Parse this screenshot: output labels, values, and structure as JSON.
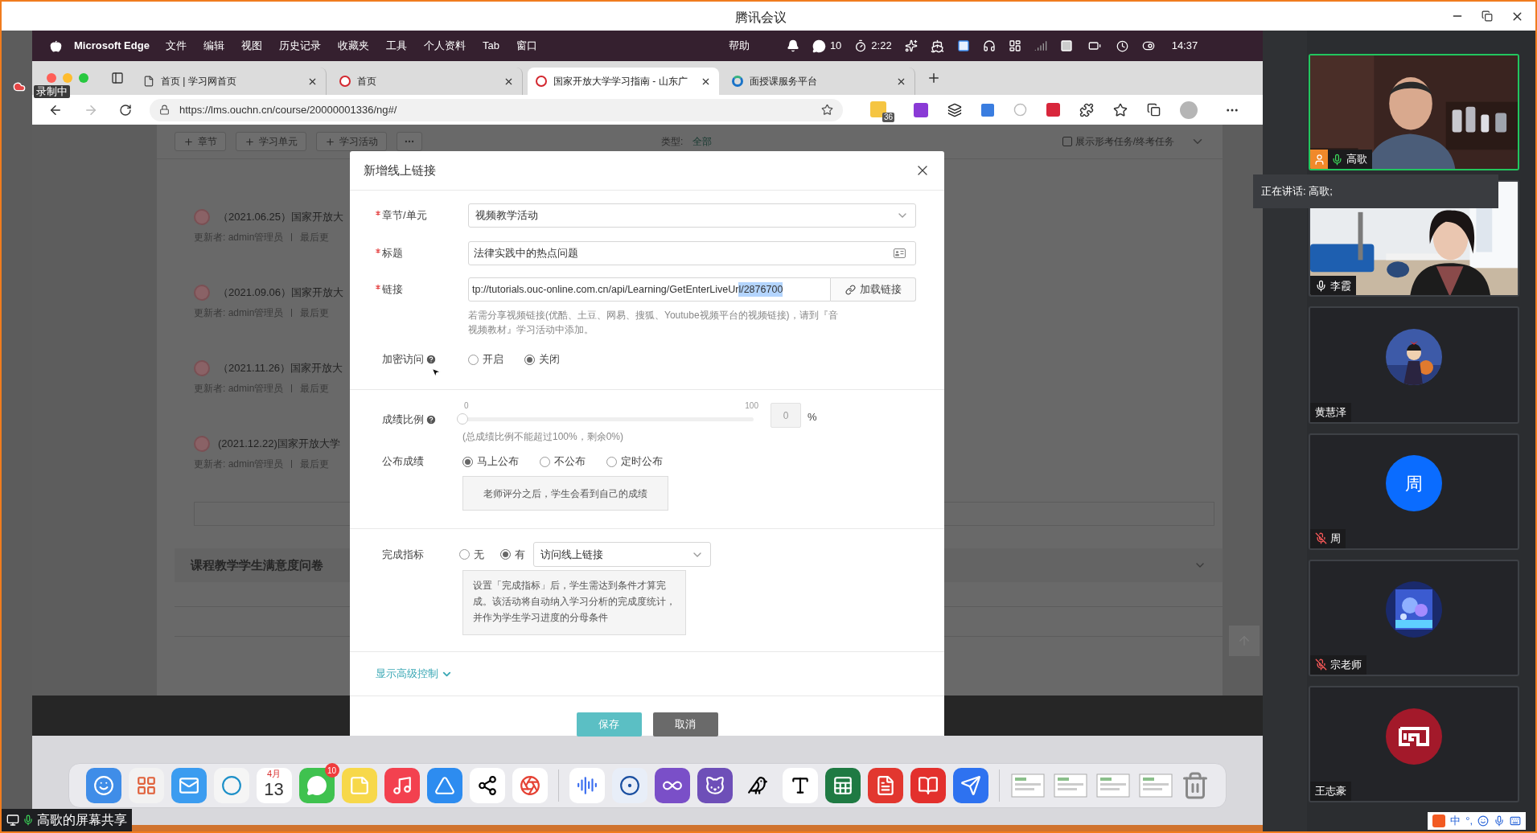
{
  "window": {
    "title": "腾讯会议"
  },
  "recording": {
    "label": "录制中"
  },
  "share_label": "高歌的屏幕共享",
  "mac_menu": {
    "app": "Microsoft Edge",
    "items": [
      "文件",
      "编辑",
      "视图",
      "历史记录",
      "收藏夹",
      "工具",
      "个人资料",
      "Tab",
      "窗口"
    ],
    "help": "帮助",
    "chat_count": "10",
    "timer": "2:22",
    "clock": "14:37"
  },
  "browser": {
    "tabs": [
      {
        "title": "首页 | 学习网首页",
        "selected": false,
        "kind": "page"
      },
      {
        "title": "首页",
        "selected": false,
        "kind": "logo"
      },
      {
        "title": "国家开放大学学习指南 - 山东广",
        "selected": true,
        "kind": "logo"
      },
      {
        "title": "面授课服务平台",
        "selected": false,
        "kind": "swirl"
      }
    ],
    "url": "https://lms.ouchn.cn/course/20000001336/ng#/",
    "extension_badge": "36"
  },
  "page": {
    "toolbar_buttons": [
      "章节",
      "学习单元",
      "学习活动"
    ],
    "type_label": "类型:",
    "type_value": "全部",
    "show_exam_tasks": {
      "label": "展示形考任务/终考任务",
      "checked": false
    },
    "items": [
      {
        "title": "（2021.06.25）国家开放大",
        "meta": "更新者: admin管理员",
        "meta_2": "最后更"
      },
      {
        "title": "（2021.09.06）国家开放大",
        "meta": "更新者: admin管理员",
        "meta_2": "最后更"
      },
      {
        "title": "（2021.11.26）国家开放大",
        "meta": "更新者: admin管理员",
        "meta_2": "最后更"
      },
      {
        "title": "(2021.12.22)国家开放大学",
        "meta": "更新者: admin管理员",
        "meta_2": "最后更"
      }
    ],
    "section_title": "课程教学学生满意度问卷"
  },
  "dialog": {
    "title": "新增线上链接",
    "chapter": {
      "label": "章节/单元",
      "required": true,
      "value": "视频教学活动"
    },
    "name": {
      "label": "标题",
      "required": true,
      "value": "法律实践中的热点问题"
    },
    "link": {
      "label": "链接",
      "required": true,
      "value": "tp://tutorials.ouc-online.com.cn/api/Learning/GetEnterLiveUr",
      "selected_text": "l/2876700",
      "button": "加载链接",
      "hint": "若需分享视频链接(优酷、土豆、网易、搜狐、Youtube视频平台的视频链接)，请到『音视频教材』学习活动中添加。"
    },
    "encrypted": {
      "label": "加密访问",
      "options": [
        {
          "label": "开启",
          "selected": false
        },
        {
          "label": "关闭",
          "selected": true
        }
      ]
    },
    "score": {
      "label": "成绩比例",
      "min": "0",
      "max": "100",
      "level": 0,
      "placeholder": "0",
      "unit": "%",
      "hint": "(总成绩比例不能超过100%，剩余0%)"
    },
    "publish": {
      "label": "公布成绩",
      "options": [
        {
          "label": "马上公布",
          "selected": true
        },
        {
          "label": "不公布",
          "selected": false
        },
        {
          "label": "定时公布",
          "selected": false
        }
      ],
      "tip": "老师评分之后，学生会看到自己的成绩"
    },
    "completion": {
      "label": "完成指标",
      "options": [
        {
          "label": "无",
          "selected": false
        },
        {
          "label": "有",
          "selected": true
        }
      ],
      "select_value": "访问线上链接",
      "tip": "设置「完成指标」后，学生需达到条件才算完成。该活动将自动纳入学习分析的完成度统计，并作为学生学习进度的分母条件"
    },
    "advanced": "显示高级控制",
    "save": "保存",
    "cancel": "取消"
  },
  "dock": {
    "calendar_month": "4月",
    "calendar_day": "13",
    "chat_badge": "10"
  },
  "meeting": {
    "speaking_now": "正在讲话: 高歌;",
    "participants": [
      {
        "name": "高歌",
        "kind": "camera",
        "muted": false,
        "host": true,
        "speaking": true
      },
      {
        "name": "李霞",
        "kind": "camera",
        "muted": false,
        "host": false,
        "speaking": false
      },
      {
        "name": "黄慧泽",
        "host": false,
        "speaking": false
      },
      {
        "name": "周",
        "kind": "letter",
        "letter": "周",
        "color": "#0a6cff",
        "muted": true,
        "host": false,
        "speaking": false
      },
      {
        "name": "宗老师",
        "muted": true,
        "host": false,
        "speaking": false
      },
      {
        "name": "王志豪",
        "kind": "emblem",
        "color": "#a3192a",
        "host": false,
        "speaking": false
      }
    ]
  },
  "ime": {
    "mode": "中",
    "punct": "°,"
  }
}
